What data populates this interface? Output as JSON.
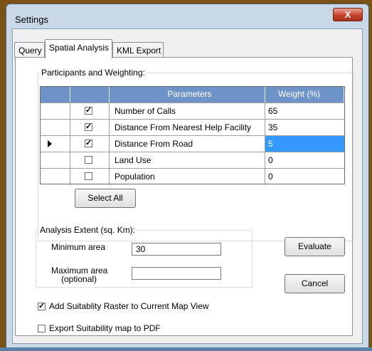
{
  "window": {
    "title": "Settings",
    "close_glyph": "X"
  },
  "tabs": [
    {
      "label": "Query",
      "active": false
    },
    {
      "label": "Spatial Analysis",
      "active": true
    },
    {
      "label": "KML Export",
      "active": false
    }
  ],
  "participants": {
    "legend": "Participants and Weighting:",
    "columns": {
      "parameters": "Parameters",
      "weight": "Weight (%)"
    },
    "rows": [
      {
        "checked": true,
        "name": "Number of Calls",
        "weight": "65",
        "current": false
      },
      {
        "checked": true,
        "name": "Distance From Nearest Help Facility",
        "weight": "35",
        "current": false
      },
      {
        "checked": true,
        "name": "Distance From Road",
        "weight": "5",
        "current": true
      },
      {
        "checked": false,
        "name": "Land Use",
        "weight": "0",
        "current": false
      },
      {
        "checked": false,
        "name": "Population",
        "weight": "0",
        "current": false
      }
    ],
    "select_all_label": "Select All"
  },
  "analysis_extent": {
    "legend": "Analysis Extent (sq. Km):",
    "min_label": "Minimum area",
    "min_value": "30",
    "max_label_line1": "Maximum area",
    "max_label_line2": "(optional)",
    "max_value": ""
  },
  "buttons": {
    "evaluate": "Evaluate",
    "cancel": "Cancel"
  },
  "options": {
    "add_raster_label": "Add Suitablity Raster to Current Map View",
    "add_raster_checked": true,
    "export_pdf_label": "Export Suitability map to PDF",
    "export_pdf_checked": false
  },
  "colors": {
    "grid_header": "#6e93c9",
    "selection": "#3399ff",
    "frame": "#c9d8e6"
  }
}
